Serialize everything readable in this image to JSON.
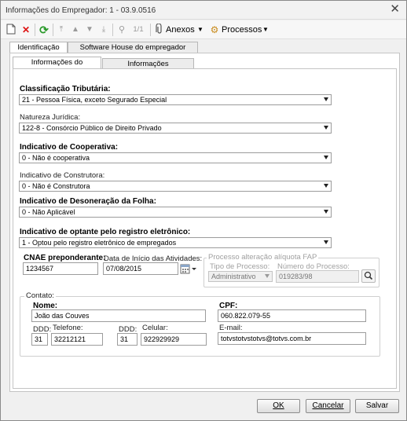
{
  "window": {
    "title": "Informações do Empregador: 1 - 03.9.0516"
  },
  "toolbar": {
    "page_indicator": "1/1",
    "anexos_label": "Anexos",
    "processos_label": "Processos"
  },
  "tabs_top": [
    "Identificação",
    "Software House do empregador"
  ],
  "tabs_inner": [
    "Informações do Empregador",
    "Informações Complementares"
  ],
  "form": {
    "classificacao": {
      "label": "Classificação Tributária:",
      "value": "21 - Pessoa Física, exceto Segurado Especial"
    },
    "natureza": {
      "label": "Natureza Jurídica:",
      "value": "122-8 - Consórcio Público de Direito Privado"
    },
    "cooperativa": {
      "label": "Indicativo de Cooperativa:",
      "value": "0 - Não é cooperativa"
    },
    "construtora": {
      "label": "Indicativo de Construtora:",
      "value": "0 - Não é Construtora"
    },
    "desoneracao": {
      "label": "Indicativo de Desoneração da Folha:",
      "value": "0 - Não Aplicável"
    },
    "registro": {
      "label": "Indicativo de optante pelo registro eletrônico:",
      "value": "1 - Optou pelo registro eletrônico de empregados"
    },
    "cnae": {
      "label": "CNAE preponderante:",
      "value": "1234567"
    },
    "data_inicio": {
      "label": "Data de Início das Atividades:",
      "value": "07/08/2015"
    },
    "processo_fap": {
      "title": "Processo alteração alíquota FAP",
      "tipo_label": "Tipo de Processo:",
      "tipo_value": "Administrativo",
      "numero_label": "Número do Processo:",
      "numero_value": "019283/98"
    }
  },
  "contato": {
    "title": "Contato:",
    "nome_label": "Nome:",
    "nome_value": "João das Couves",
    "cpf_label": "CPF:",
    "cpf_value": "060.822.079-55",
    "ddd_label": "DDD:",
    "telefone_label": "Telefone:",
    "ddd_tel_value": "31",
    "telefone_value": "32212121",
    "ddd2_label": "DDD:",
    "celular_label": "Celular:",
    "ddd_cel_value": "31",
    "celular_value": "922929929",
    "email_label": "E-mail:",
    "email_value": "totvstotvstotvs@totvs.com.br"
  },
  "buttons": {
    "ok": "OK",
    "cancelar": "Cancelar",
    "salvar": "Salvar"
  }
}
